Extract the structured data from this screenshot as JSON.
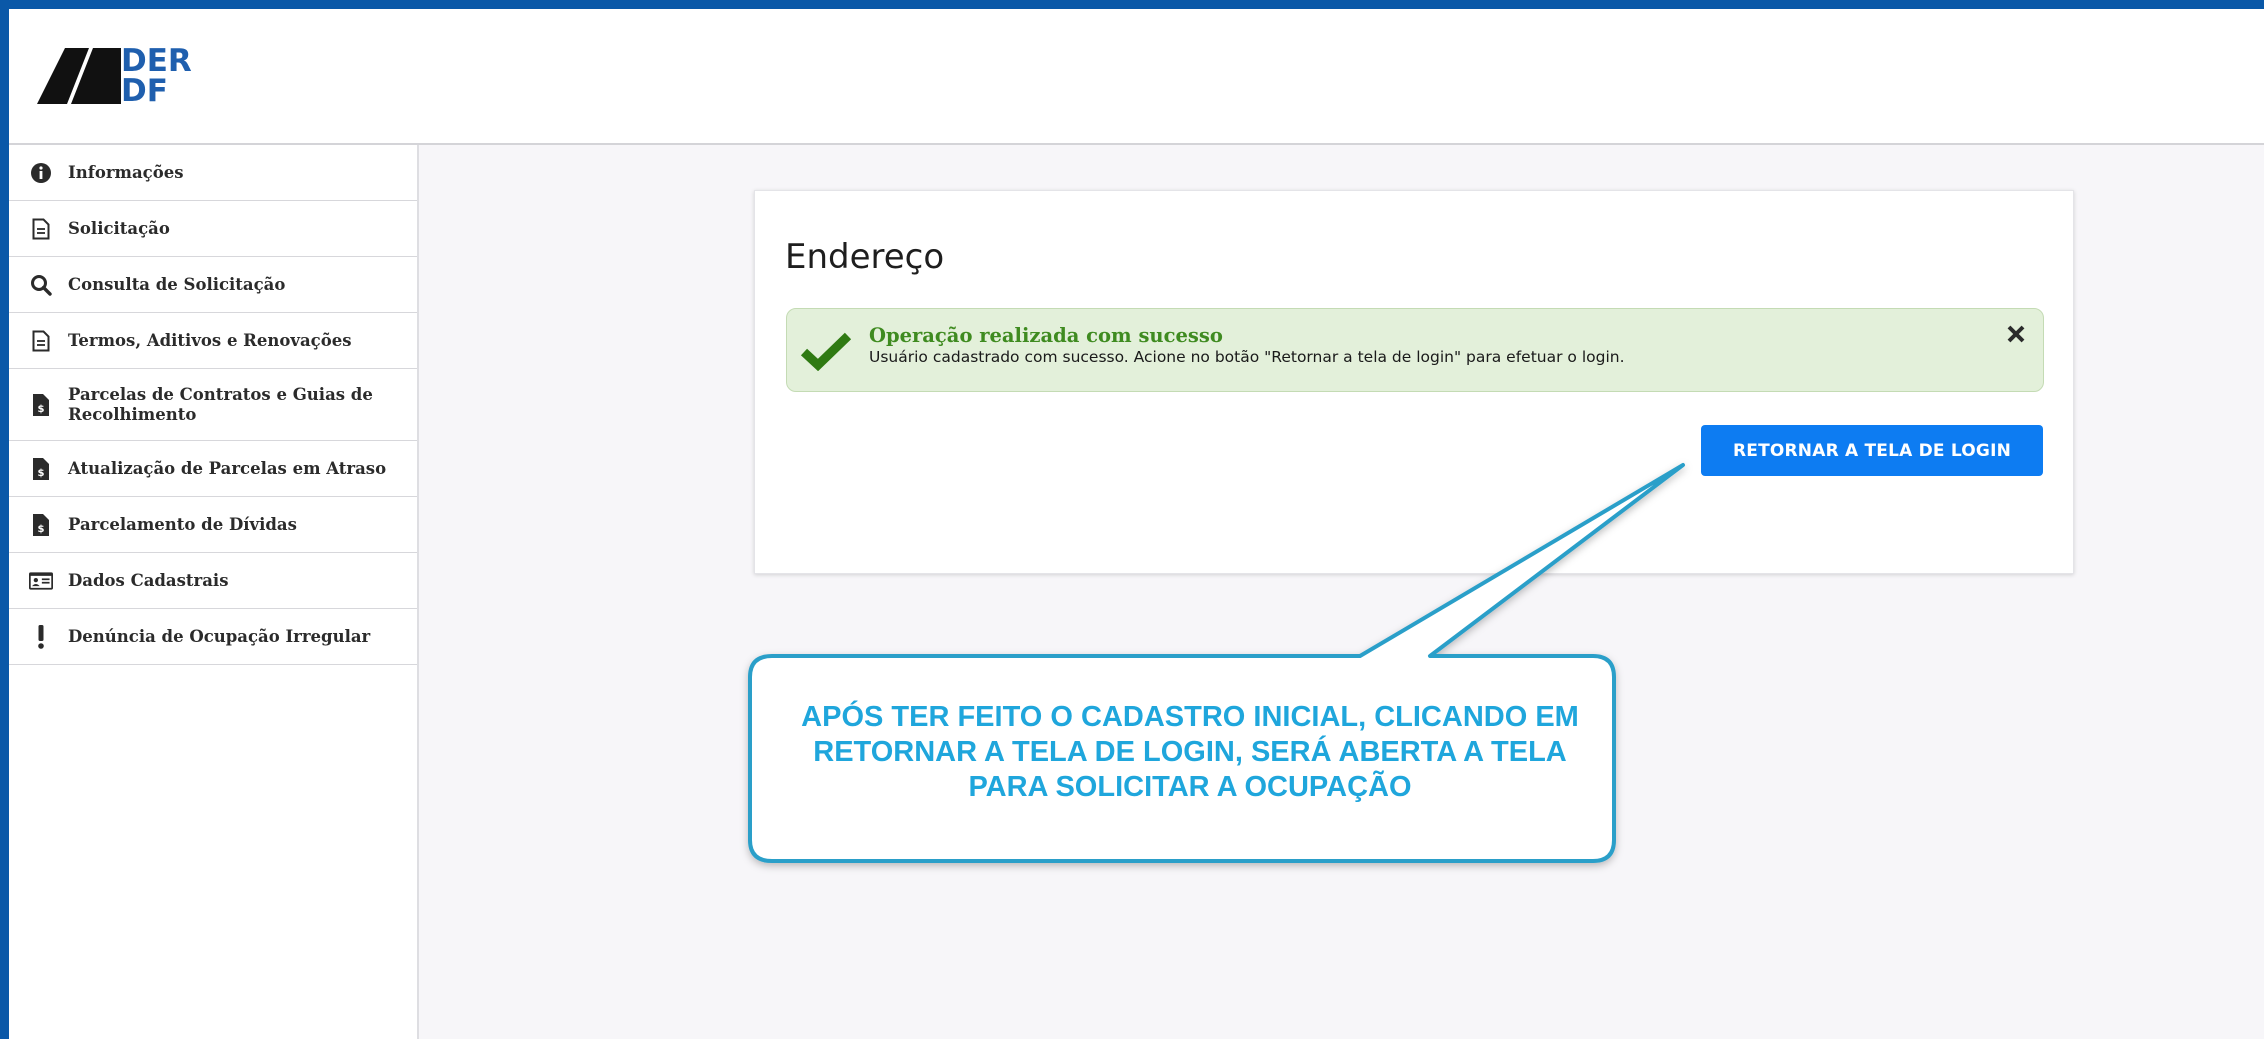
{
  "logo": {
    "line1": "DER",
    "line2": "DF"
  },
  "sidebar": {
    "items": [
      {
        "label": "Informações",
        "icon": "info-circle-icon"
      },
      {
        "label": "Solicitação",
        "icon": "document-icon"
      },
      {
        "label": "Consulta de Solicitação",
        "icon": "search-icon"
      },
      {
        "label": "Termos, Aditivos e Renovações",
        "icon": "document-icon"
      },
      {
        "label": "Parcelas de Contratos e Guias de Recolhimento",
        "icon": "invoice-dollar-icon"
      },
      {
        "label": "Atualização de Parcelas em Atraso",
        "icon": "invoice-dollar-icon"
      },
      {
        "label": "Parcelamento de Dívidas",
        "icon": "invoice-dollar-icon"
      },
      {
        "label": "Dados Cadastrais",
        "icon": "id-card-icon"
      },
      {
        "label": "Denúncia de Ocupação Irregular",
        "icon": "exclamation-icon"
      }
    ]
  },
  "card": {
    "title": "Endereço",
    "alert": {
      "title": "Operação realizada com sucesso",
      "message": "Usuário cadastrado com sucesso. Acione no botão \"Retornar a tela de login\" para efetuar o login."
    },
    "button_label": "RETORNAR A TELA DE LOGIN"
  },
  "callout": {
    "line1": "APÓS TER FEITO O CADASTRO INICIAL, CLICANDO EM",
    "line2": "RETORNAR A TELA DE LOGIN, SERÁ ABERTA A TELA",
    "line3": "PARA SOLICITAR A OCUPAÇÃO"
  },
  "colors": {
    "frame_border": "#0a58a8",
    "primary_button": "#0d7cf2",
    "success_bg": "#e3f0da",
    "success_title": "#3f8b20",
    "callout_text": "#1fa6dc",
    "callout_border": "#2a9fc9"
  }
}
